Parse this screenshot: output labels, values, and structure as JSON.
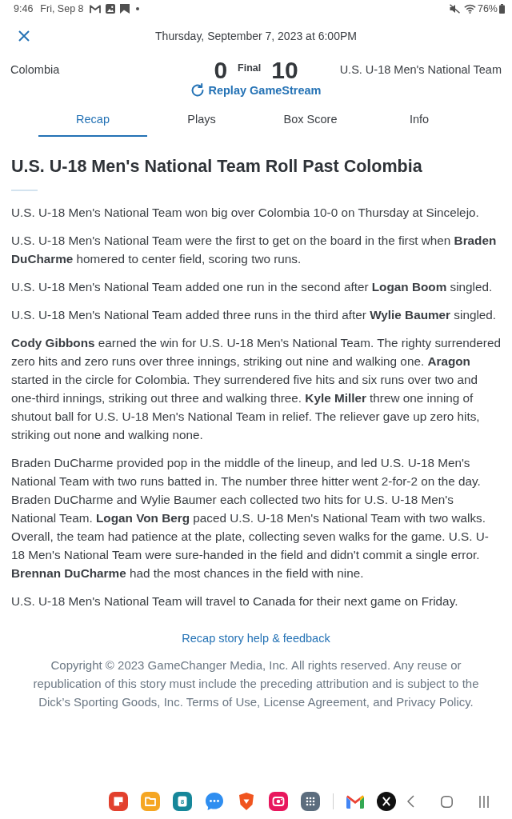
{
  "status_bar": {
    "time": "9:46",
    "date": "Fri, Sep 8",
    "battery": "76%"
  },
  "header": {
    "datetime": "Thursday, September 7, 2023 at 6:00PM"
  },
  "scoreboard": {
    "away_team": "Colombia",
    "away_score": "0",
    "status": "Final",
    "home_score": "10",
    "home_team": "U.S. U-18 Men's National Team",
    "replay_link": "Replay GameStream"
  },
  "tabs": [
    {
      "label": "Recap",
      "selected": true
    },
    {
      "label": "Plays",
      "selected": false
    },
    {
      "label": "Box Score",
      "selected": false
    },
    {
      "label": "Info",
      "selected": false
    }
  ],
  "article": {
    "title": "U.S. U-18 Men's National Team Roll Past Colombia",
    "paragraphs": [
      "U.S. U-18 Men's National Team won big over Colombia 10-0 on Thursday at Sincelejo.",
      "U.S. U-18 Men's National Team were the first to get on the board in the first when **Braden DuCharme** homered to center field, scoring two runs.",
      "U.S. U-18 Men's National Team added one run in the second after **Logan Boom** singled.",
      "U.S. U-18 Men's National Team added three runs in the third after **Wylie Baumer** singled.",
      "**Cody Gibbons** earned the win for U.S. U-18 Men's National Team. The righty surrendered zero hits and zero runs over three innings, striking out nine and walking one. **Aragon** started in the circle for Colombia. They surrendered five hits and six runs over two and one-third innings, striking out three and walking three. **Kyle Miller** threw one inning of shutout ball for U.S. U-18 Men's National Team in relief. The reliever gave up zero hits, striking out none and walking none.",
      "Braden DuCharme provided pop in the middle of the lineup, and led U.S. U-18 Men's National Team with two runs batted in. The number three hitter went 2-for-2 on the day. Braden DuCharme and Wylie Baumer each collected two hits for U.S. U-18 Men's National Team. **Logan Von Berg** paced U.S. U-18 Men's National Team with two walks. Overall, the team had patience at the plate, collecting seven walks for the game. U.S. U-18 Men's National Team were sure-handed in the field and didn't commit a single error. **Brennan DuCharme** had the most chances in the field with nine.",
      "U.S. U-18 Men's National Team will travel to Canada for their next game on Friday."
    ]
  },
  "footer": {
    "help_link": "Recap story help & feedback",
    "copyright": "Copyright © 2023 GameChanger Media, Inc. All rights reserved. Any reuse or republication of this story must include the preceding attribution and is subject to the Dick’s Sporting Goods, Inc. Terms of Use, License Agreement, and Privacy Policy."
  },
  "taskbar": {
    "calendar_day": "8"
  }
}
